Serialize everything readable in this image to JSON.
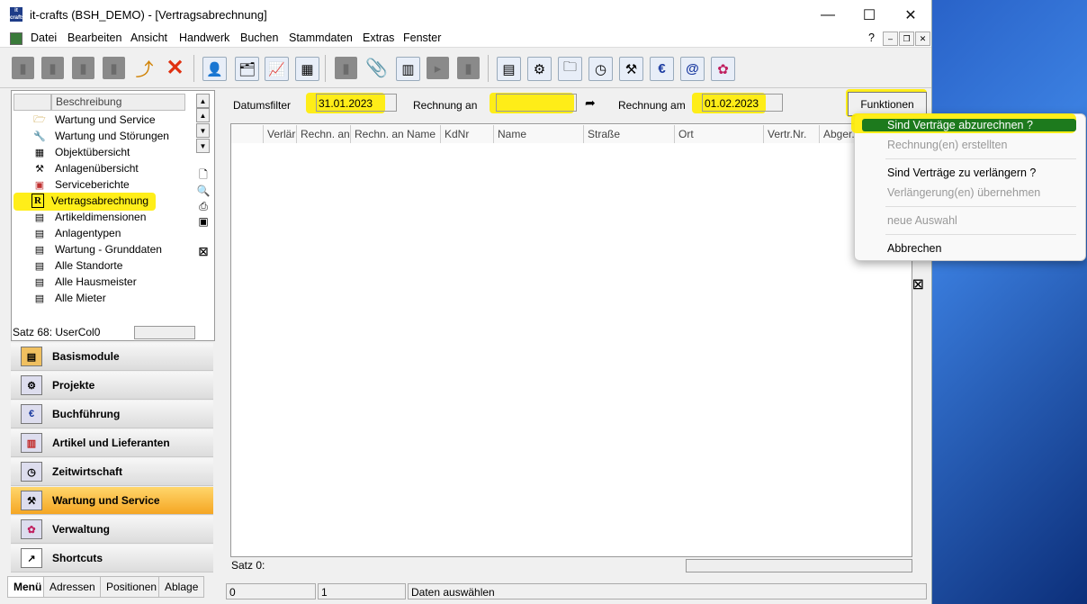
{
  "window": {
    "app_logo": "it crafts",
    "title": "it-crafts (BSH_DEMO) - [Vertragsabrechnung]",
    "controls": {
      "minimize": "—",
      "maximize": "☐",
      "close": "✕"
    }
  },
  "menubar": {
    "items": [
      "Datei",
      "Bearbeiten",
      "Ansicht",
      "Handwerk",
      "Buchen",
      "Stammdaten",
      "Extras",
      "Fenster"
    ],
    "help": "?",
    "mdi_min": "–",
    "mdi_restore": "❐",
    "mdi_close": "✕"
  },
  "toolbar": {
    "icons": [
      "doc-icon",
      "doc-icon",
      "save-icon",
      "print-icon",
      "export-arrow-icon",
      "delete-x-icon",
      "person-card-icon",
      "folder-icon",
      "chart-icon",
      "calculator-icon",
      "gray-icon",
      "paperclip-icon",
      "calendar-icon",
      "arrow-box-icon",
      "gray-icon",
      "modules-icon",
      "projects-icon",
      "folders-icon",
      "clock-icon",
      "service-icon",
      "euro-icon",
      "email-icon",
      "settings-icon"
    ]
  },
  "left_panel": {
    "column_header": "Beschreibung",
    "items": [
      {
        "label": "Wartung und Service",
        "icon": "folder-open-icon"
      },
      {
        "label": "Wartung und Störungen",
        "icon": "wrench-icon"
      },
      {
        "label": "Objektübersicht",
        "icon": "building-icon"
      },
      {
        "label": "Anlagenübersicht",
        "icon": "tools-icon"
      },
      {
        "label": "Serviceberichte",
        "icon": "report-icon"
      },
      {
        "label": "Vertragsabrechnung",
        "icon": "invoice-r-icon"
      },
      {
        "label": "Artikeldimensionen",
        "icon": "list-icon"
      },
      {
        "label": "Anlagentypen",
        "icon": "list-icon"
      },
      {
        "label": "Wartung - Grunddaten",
        "icon": "list-icon"
      },
      {
        "label": "Alle Standorte",
        "icon": "list-icon"
      },
      {
        "label": "Alle Hausmeister",
        "icon": "list-icon"
      },
      {
        "label": "Alle Mieter",
        "icon": "list-icon"
      }
    ],
    "status": "Satz 68: UserCol0"
  },
  "nav": {
    "buttons": [
      {
        "label": "Basismodule",
        "active": false
      },
      {
        "label": "Projekte",
        "active": false
      },
      {
        "label": "Buchführung",
        "active": false
      },
      {
        "label": "Artikel und Lieferanten",
        "active": false
      },
      {
        "label": "Zeitwirtschaft",
        "active": false
      },
      {
        "label": "Wartung und Service",
        "active": true
      },
      {
        "label": "Verwaltung",
        "active": false
      },
      {
        "label": "Shortcuts",
        "active": false
      }
    ],
    "tabs": [
      "Menü",
      "Adressen",
      "Positionen",
      "Ablage"
    ]
  },
  "filters": {
    "datumsfilter_label": "Datumsfilter",
    "datumsfilter_value": "31.01.2023",
    "rechnung_an_label": "Rechnung an",
    "rechnung_an_value": "",
    "rechnung_am_label": "Rechnung am",
    "rechnung_am_value": "01.02.2023",
    "funktionen_label": "Funktionen"
  },
  "grid": {
    "columns": [
      "Verlär",
      "Rechn. an",
      "Rechn. an Name",
      "KdNr",
      "Name",
      "Straße",
      "Ort",
      "Vertr.Nr.",
      "Abger.I"
    ],
    "status": "Satz 0:"
  },
  "statusbar": {
    "cell1": "0",
    "cell2": "1",
    "cell3": "Daten auswählen"
  },
  "dropdown": {
    "items": [
      {
        "label": "Sind Verträge abzurechnen ?",
        "enabled": true,
        "selected": true
      },
      {
        "label": "Rechnung(en) erstellten",
        "enabled": false
      },
      {
        "label": "Sind Verträge zu verlängern ?",
        "enabled": true
      },
      {
        "label": "Verlängerung(en) übernehmen",
        "enabled": false
      },
      {
        "label": "neue Auswahl",
        "enabled": false
      },
      {
        "label": "Abbrechen",
        "enabled": true
      }
    ]
  },
  "colors": {
    "highlight": "#ffec00",
    "active_nav": "#f5a623",
    "selected_menu": "#1d7a1d"
  }
}
